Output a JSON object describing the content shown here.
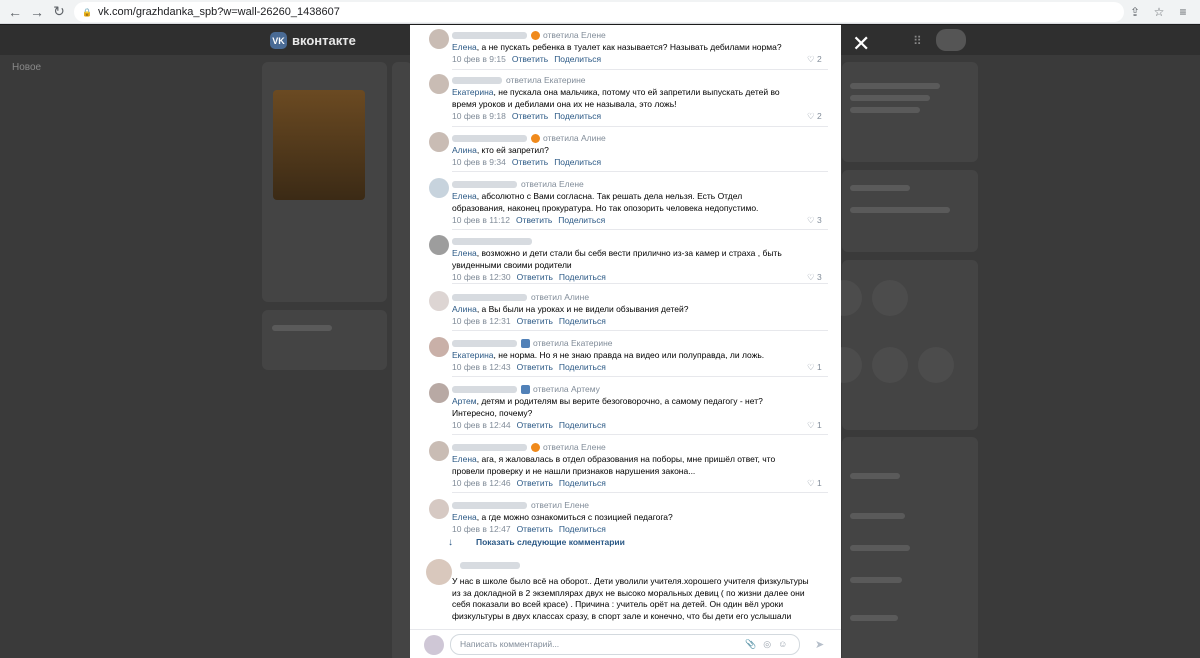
{
  "browser": {
    "url": "vk.com/grazhdanka_spb?w=wall-26260_1438607",
    "back_icon": "←",
    "forward_icon": "→",
    "reload_icon": "↻",
    "lock_icon": "🔒",
    "share_icon": "⇪",
    "star_icon": "☆",
    "menu_icon": "≡"
  },
  "background": {
    "logo_text": "вконтакте",
    "logo_mark": "VK",
    "left_nav_label": "Новое",
    "close_icon": "✕"
  },
  "comments": [
    {
      "reply_to": "ответила Елене",
      "mention": "Елена",
      "text": ", а не пускать ребенка в туалет как называется? Называть дебилами норма?",
      "date": "10 фев в 9:15",
      "likes": "2",
      "badge": "orange"
    },
    {
      "reply_to": "ответила Екатерине",
      "mention": "Екатерина",
      "text": ", не пускала она мальчика, потому что ей запретили выпускать детей во время уроков и дебилами она их не называла, это ложь!",
      "date": "10 фев в 9:18",
      "likes": "2",
      "badge": ""
    },
    {
      "reply_to": "ответила Алине",
      "mention": "Алина",
      "text": ", кто ей запретил?",
      "date": "10 фев в 9:34",
      "likes": "",
      "badge": "orange"
    },
    {
      "reply_to": "ответила Елене",
      "mention": "Елена",
      "text": ", абсолютно с Вами согласна. Так решать дела нельзя. Есть Отдел образования, наконец прокуратура. Но так опозорить человека недопустимо.",
      "date": "10 фев в 11:12",
      "likes": "3",
      "badge": ""
    },
    {
      "reply_to": "",
      "mention": "Елена",
      "text": ", возможно и дети стали бы себя вести прилично из-за камер и страха , быть увиденными своими родители",
      "date": "10 фев в 12:30",
      "likes": "3",
      "badge": ""
    },
    {
      "reply_to": "ответил Алине",
      "mention": "Алина",
      "text": ", а Вы были на уроках и не видели обзывания детей?",
      "date": "10 фев в 12:31",
      "likes": "",
      "badge": ""
    },
    {
      "reply_to": "ответила Екатерине",
      "mention": "Екатерина",
      "text": ", не норма. Но я не знаю правда на видео или полуправда, ли ложь.",
      "date": "10 фев в 12:43",
      "likes": "1",
      "badge": "blue"
    },
    {
      "reply_to": "ответила Артему",
      "mention": "Артем",
      "text": ", детям и родителям вы верите безоговорочно, а самому педагогу - нет? Интересно, почему?",
      "date": "10 фев в 12:44",
      "likes": "1",
      "badge": "blue"
    },
    {
      "reply_to": "ответила Елене",
      "mention": "Елена",
      "text": ", ага, я жаловалась в отдел образования на поборы, мне пришёл ответ, что провели проверку и не нашли признаков нарушения закона...",
      "date": "10 фев в 12:46",
      "likes": "1",
      "badge": "orange"
    },
    {
      "reply_to": "ответил Елене",
      "mention": "Елена",
      "text": ", а где можно ознакомиться с позицией педагога?",
      "date": "10 фев в 12:47",
      "likes": "",
      "badge": ""
    }
  ],
  "actions": {
    "reply": "Ответить",
    "share": "Поделиться",
    "like_icon": "♡",
    "more_comments": "Показать следующие комментарии",
    "more_arrow": "↓"
  },
  "root_comment": {
    "text": "У нас в школе было всё на оборот.. Дети уволили учителя.хорошего учителя физкультуры из за докладной в 2 экземплярах двух не высоко моральных девиц ( по жизни далее они себя показали во всей красе) . Причина : учитель орёт на детей. Он один вёл уроки физкультуры в двух классах сразу, в спорт зале и конечно, что бы дети его услышали"
  },
  "write": {
    "placeholder": "Написать комментарий...",
    "attach_icon": "📎",
    "camera_icon": "◎",
    "emoji_icon": "☺",
    "send_icon": "➤"
  },
  "colors": {
    "link": "#2a5885",
    "meta": "#818c99",
    "overlay": "#1c1c1c"
  }
}
